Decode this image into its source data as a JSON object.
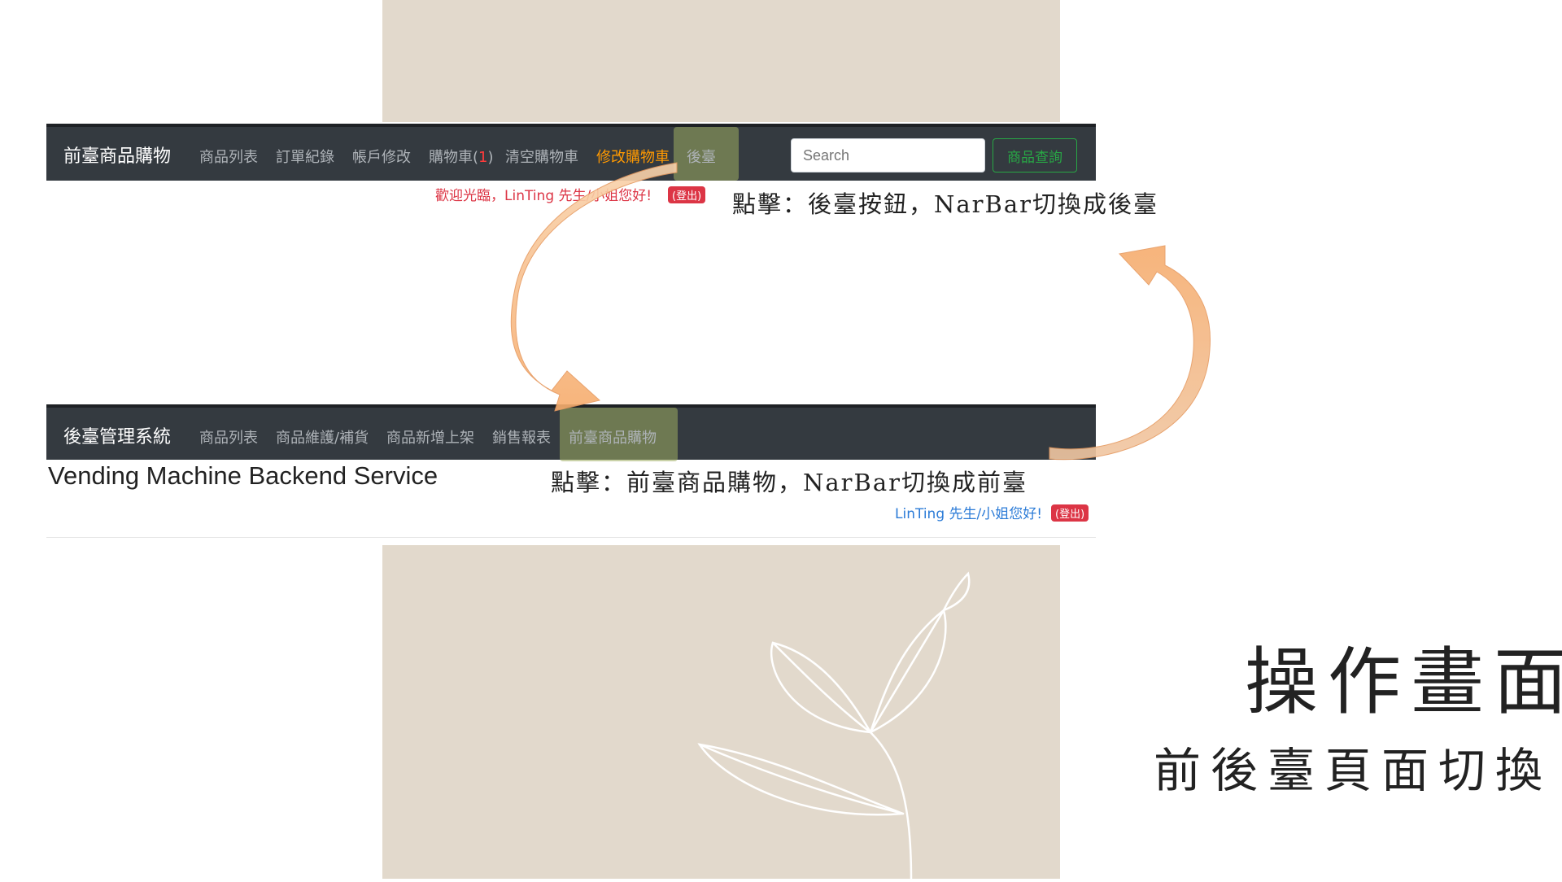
{
  "frontend_nav": {
    "brand": "前臺商品購物",
    "items": [
      {
        "label": "商品列表"
      },
      {
        "label": "訂單紀錄"
      },
      {
        "label": "帳戶修改"
      }
    ],
    "cart_label": "購物車(",
    "cart_count": "1",
    "cart_close": ")",
    "clear_cart": "清空購物車",
    "modify_cart": "修改購物車",
    "backend_link": "後臺",
    "search_placeholder": "Search",
    "query_button": "商品查詢"
  },
  "frontend_welcome": {
    "text": "歡迎光臨，LinTing 先生/小姐您好!",
    "logout": "(登出)"
  },
  "backend_nav": {
    "brand": "後臺管理系統",
    "items": [
      {
        "label": "商品列表"
      },
      {
        "label": "商品維護/補貨"
      },
      {
        "label": "商品新增上架"
      },
      {
        "label": "銷售報表"
      }
    ],
    "frontend_link": "前臺商品購物"
  },
  "backend_page": {
    "title": "Vending Machine Backend Service",
    "welcome": "LinTing 先生/小姐您好!",
    "logout": "(登出)"
  },
  "annotations": {
    "top": "點擊：後臺按鈕，NarBar切換成後臺",
    "bottom": "點擊：前臺商品購物，NarBar切換成前臺"
  },
  "slide": {
    "title": "操作畫面",
    "subtitle": "前後臺頁面切換"
  },
  "colors": {
    "navbar": "#343a40",
    "beige_panel": "#e2d9cc",
    "active_orange": "#ff9900",
    "highlight": "#9fad60",
    "arrow": "#f7b27c"
  }
}
